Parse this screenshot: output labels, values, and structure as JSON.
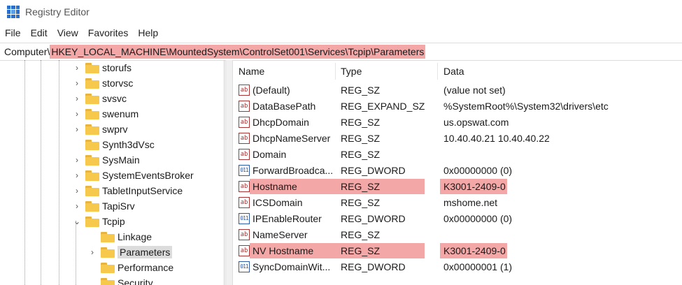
{
  "window": {
    "title": "Registry Editor"
  },
  "menu": [
    "File",
    "Edit",
    "View",
    "Favorites",
    "Help"
  ],
  "address": {
    "prefix": "Computer\\",
    "path": "HKEY_LOCAL_MACHINE\\MountedSystem\\ControlSet001\\Services\\Tcpip\\Parameters"
  },
  "tree": [
    {
      "label": "storufs",
      "chevron": "›"
    },
    {
      "label": "storvsc",
      "chevron": "›"
    },
    {
      "label": "svsvc",
      "chevron": "›"
    },
    {
      "label": "swenum",
      "chevron": "›"
    },
    {
      "label": "swprv",
      "chevron": "›"
    },
    {
      "label": "Synth3dVsc",
      "chevron": ""
    },
    {
      "label": "SysMain",
      "chevron": "›"
    },
    {
      "label": "SystemEventsBroker",
      "chevron": "›"
    },
    {
      "label": "TabletInputService",
      "chevron": "›"
    },
    {
      "label": "TapiSrv",
      "chevron": "›"
    },
    {
      "label": "Tcpip",
      "chevron": "⌄"
    },
    {
      "label": "Linkage",
      "chevron": ""
    },
    {
      "label": "Parameters",
      "chevron": "›",
      "selected": true
    },
    {
      "label": "Performance",
      "chevron": ""
    },
    {
      "label": "Security",
      "chevron": ""
    }
  ],
  "columns": {
    "name": "Name",
    "type": "Type",
    "data": "Data"
  },
  "values": [
    {
      "icon": "ab",
      "name": "(Default)",
      "type": "REG_SZ",
      "data": "(value not set)"
    },
    {
      "icon": "ab",
      "name": "DataBasePath",
      "type": "REG_EXPAND_SZ",
      "data": "%SystemRoot%\\System32\\drivers\\etc"
    },
    {
      "icon": "ab",
      "name": "DhcpDomain",
      "type": "REG_SZ",
      "data": "us.opswat.com"
    },
    {
      "icon": "ab",
      "name": "DhcpNameServer",
      "type": "REG_SZ",
      "data": "10.40.40.21 10.40.40.22"
    },
    {
      "icon": "ab",
      "name": "Domain",
      "type": "REG_SZ",
      "data": ""
    },
    {
      "icon": "bin",
      "name": "ForwardBroadca...",
      "type": "REG_DWORD",
      "data": "0x00000000 (0)"
    },
    {
      "icon": "ab",
      "name": "Hostname",
      "type": "REG_SZ",
      "data": "K3001-2409-0",
      "highlight": true
    },
    {
      "icon": "ab",
      "name": "ICSDomain",
      "type": "REG_SZ",
      "data": "mshome.net"
    },
    {
      "icon": "bin",
      "name": "IPEnableRouter",
      "type": "REG_DWORD",
      "data": "0x00000000 (0)"
    },
    {
      "icon": "ab",
      "name": "NameServer",
      "type": "REG_SZ",
      "data": ""
    },
    {
      "icon": "ab",
      "name": "NV Hostname",
      "type": "REG_SZ",
      "data": "K3001-2409-0",
      "highlight": true
    },
    {
      "icon": "bin",
      "name": "SyncDomainWit...",
      "type": "REG_DWORD",
      "data": "0x00000001 (1)"
    }
  ],
  "colors": {
    "highlight": "#f4a7a7",
    "accent": "#2a6fc9"
  }
}
